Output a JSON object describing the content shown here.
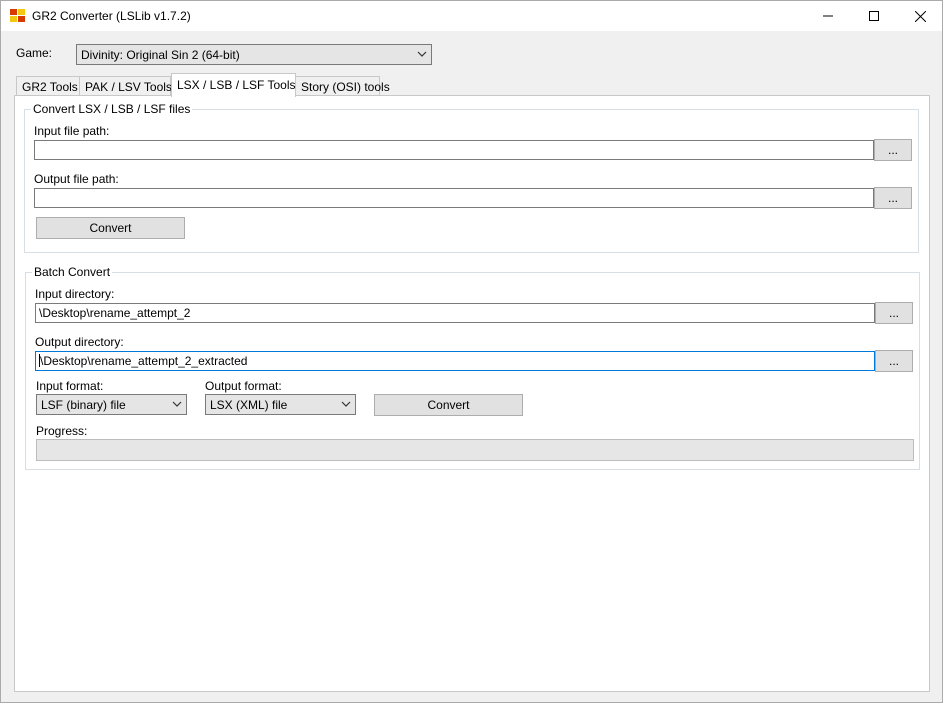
{
  "window": {
    "title": "GR2 Converter (LSLib v1.7.2)",
    "app_icon": "app-icon",
    "controls": [
      "minimize-icon",
      "maximize-icon",
      "close-icon"
    ]
  },
  "game": {
    "label": "Game:",
    "selected": "Divinity: Original Sin 2 (64-bit)"
  },
  "tabs": [
    {
      "label": "GR2 Tools",
      "active": false
    },
    {
      "label": "PAK / LSV Tools",
      "active": false
    },
    {
      "label": "LSX / LSB / LSF Tools",
      "active": true
    },
    {
      "label": "Story (OSI) tools",
      "active": false
    }
  ],
  "convert_group": {
    "title": "Convert LSX / LSB / LSF files",
    "input_label": "Input file path:",
    "input_value": "",
    "output_label": "Output file path:",
    "output_value": "",
    "browse_label": "...",
    "convert_label": "Convert"
  },
  "batch_group": {
    "title": "Batch Convert",
    "input_dir_label": "Input directory:",
    "input_dir_value": "\\Desktop\\rename_attempt_2",
    "output_dir_label": "Output directory:",
    "output_dir_value": "\\Desktop\\rename_attempt_2_extracted",
    "browse_label": "...",
    "input_format_label": "Input format:",
    "input_format_value": "LSF (binary) file",
    "output_format_label": "Output format:",
    "output_format_value": "LSX (XML) file",
    "convert_label": "Convert",
    "progress_label": "Progress:",
    "progress": 0
  },
  "colors": {
    "focus_border": "#0078d7",
    "window_bg": "#f0f0f0",
    "panel_bg": "#ffffff"
  }
}
